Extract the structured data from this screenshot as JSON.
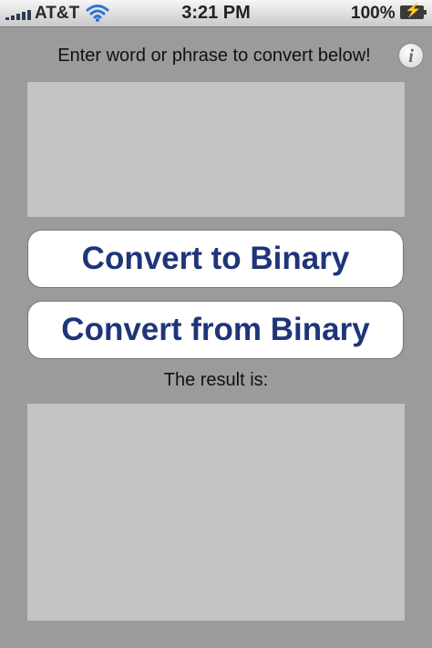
{
  "status_bar": {
    "carrier": "AT&T",
    "time": "3:21 PM",
    "battery_percent": "100%"
  },
  "header": {
    "instruction": "Enter word or phrase to convert below!",
    "info_icon_glyph": "i"
  },
  "input": {
    "value": "",
    "placeholder": ""
  },
  "buttons": {
    "to_binary": "Convert to Binary",
    "from_binary": "Convert from Binary"
  },
  "result": {
    "label": "The result is:",
    "value": ""
  },
  "colors": {
    "background": "#9b9b9b",
    "text_box": "#c3c3c3",
    "button_text": "#1f3479",
    "button_bg": "#ffffff"
  }
}
